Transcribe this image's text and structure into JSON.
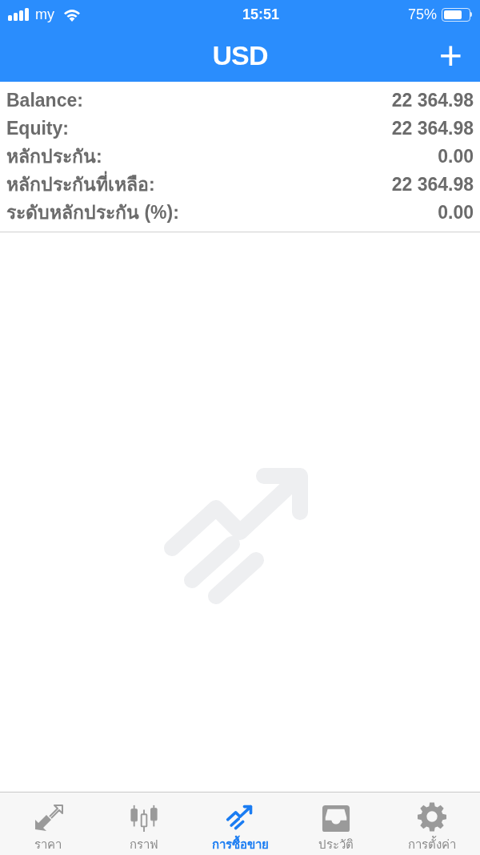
{
  "status_bar": {
    "carrier": "my",
    "time": "15:51",
    "battery": "75%"
  },
  "nav_bar": {
    "title": "USD",
    "action": "+"
  },
  "account": [
    {
      "label": "Balance:",
      "value": "22 364.98"
    },
    {
      "label": "Equity:",
      "value": "22 364.98"
    },
    {
      "label": "หลักประกัน:",
      "value": "0.00"
    },
    {
      "label": "หลักประกันที่เหลือ:",
      "value": "22 364.98"
    },
    {
      "label": "ระดับหลักประกัน (%):",
      "value": "0.00"
    }
  ],
  "tabs": [
    {
      "label": "ราคา",
      "kind": "quotes",
      "selected": false
    },
    {
      "label": "กราฟ",
      "kind": "chart",
      "selected": false
    },
    {
      "label": "การซื้อขาย",
      "kind": "trade",
      "selected": true
    },
    {
      "label": "ประวัติ",
      "kind": "history",
      "selected": false
    },
    {
      "label": "การตั้งค่า",
      "kind": "settings",
      "selected": false
    }
  ]
}
